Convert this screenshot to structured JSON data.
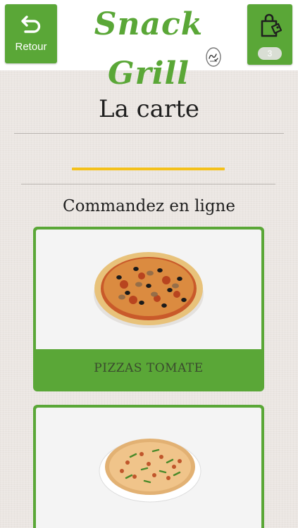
{
  "header": {
    "back_label": "Retour",
    "logo_text": "Snack Grill",
    "cart_count": "3"
  },
  "main": {
    "title": "La carte",
    "subtitle": "Commandez en ligne",
    "categories": [
      {
        "label": "PIZZAS TOMATE"
      },
      {
        "label": ""
      }
    ]
  },
  "colors": {
    "accent_green": "#5aa737",
    "accent_yellow": "#f4c11b",
    "background": "#ebe6e2"
  },
  "icons": [
    "undo-arrow-icon",
    "shopping-bag-icon",
    "halal-icon"
  ]
}
